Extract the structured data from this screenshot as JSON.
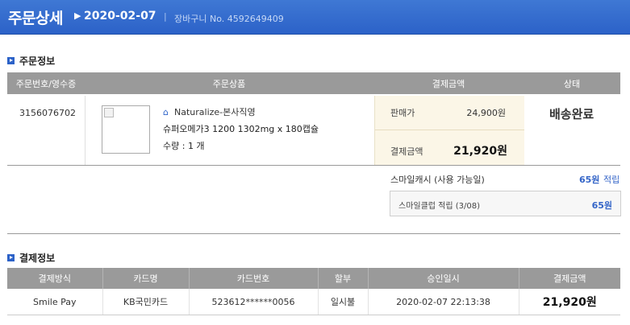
{
  "header": {
    "title": "주문상세",
    "date": "2020-02-07",
    "separator": "|",
    "cart_label": "장바구니 No. 4592649409"
  },
  "order_info": {
    "section_title": "주문정보",
    "columns": [
      "주문번호/영수증",
      "주문상품",
      "결제금액",
      "상태"
    ],
    "order_number": "3156076702",
    "seller": "Naturalize-본사직영",
    "product_name": "슈퍼오메가3 1200 1302mg x 180캡슐",
    "quantity": "수량 : 1 개",
    "sale_price_label": "판매가",
    "sale_price": "24,900원",
    "paid_label": "결제금액",
    "paid_amount": "21,920원",
    "status": "배송완료",
    "smile_cash_label": "스마일캐시 (사용 가능일)",
    "smile_cash_value": "65원",
    "smile_cash_action": "적립",
    "smile_club_label": "스마일클럽 적립 (3/08)",
    "smile_club_value": "65원"
  },
  "payment_info": {
    "section_title": "결제정보",
    "columns": [
      "결제방식",
      "카드명",
      "카드번호",
      "할부",
      "승인일시",
      "결제금액"
    ],
    "rows": [
      [
        "Smile Pay",
        "KB국민카드",
        "523612******0056",
        "일시불",
        "2020-02-07 22:13:38",
        "21,920원"
      ]
    ]
  },
  "colors": {
    "header_bg": "#2c62c8",
    "accent_blue": "#3465c8",
    "table_header_bg": "#9a9a9a",
    "price_box_bg": "#fbf6e7"
  },
  "icons": {
    "section_bullet": "square-arrow-icon",
    "seller_home": "home-icon",
    "product_image": "broken-image-icon"
  }
}
